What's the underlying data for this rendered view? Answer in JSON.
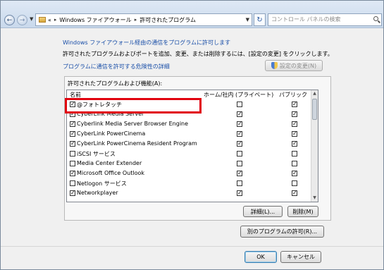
{
  "nav": {
    "back_glyph": "←",
    "forward_glyph": "→",
    "dropdown_glyph": "▼",
    "address": {
      "overflow": "«",
      "crumbs": [
        "Windows ファイアウォール",
        "許可されたプログラム"
      ],
      "separator": "▸"
    },
    "refresh_glyph": "↻",
    "search_placeholder": "コントロール パネルの検索"
  },
  "content": {
    "header_link": "Windows ファイアウォール経由の通信をプログラムに許可します",
    "description": "許可されたプログラムおよびポートを追加、変更、または削除するには、[設定の変更] をクリックします。",
    "risk_link": "プログラムに通信を許可する危険性の詳細",
    "change_settings_button": "設定の変更(N)"
  },
  "programs": {
    "group_label": "許可されたプログラムおよび機能(A):",
    "columns": {
      "name": "名前",
      "home": "ホーム/社内 (プライベート)",
      "public": "パブリック"
    },
    "rows": [
      {
        "name": "@フォトレタッチ",
        "enabled": true,
        "home": false,
        "public": true
      },
      {
        "name": "CyberLink Media Server",
        "enabled": true,
        "home": true,
        "public": true
      },
      {
        "name": "Cyberlink Media Server Browser Engine",
        "enabled": true,
        "home": true,
        "public": true
      },
      {
        "name": "CyberLink PowerCinema",
        "enabled": true,
        "home": true,
        "public": true
      },
      {
        "name": "CyberLink PowerCinema Resident Program",
        "enabled": true,
        "home": true,
        "public": true
      },
      {
        "name": "iSCSI サービス",
        "enabled": false,
        "home": false,
        "public": false
      },
      {
        "name": "Media Center Extender",
        "enabled": false,
        "home": false,
        "public": false
      },
      {
        "name": "Microsoft Office Outlook",
        "enabled": true,
        "home": true,
        "public": true
      },
      {
        "name": "Netlogon サービス",
        "enabled": false,
        "home": false,
        "public": false
      },
      {
        "name": "Networkplayer",
        "enabled": true,
        "home": true,
        "public": true
      }
    ],
    "details_button": "詳細(L)...",
    "remove_button": "削除(M)"
  },
  "allow_other_button": "別のプログラムの許可(R)...",
  "ok_button": "OK",
  "cancel_button": "キャンセル",
  "check_glyph": "✓",
  "colors": {
    "link": "#1a4fa8",
    "highlight": "#e1000f"
  }
}
